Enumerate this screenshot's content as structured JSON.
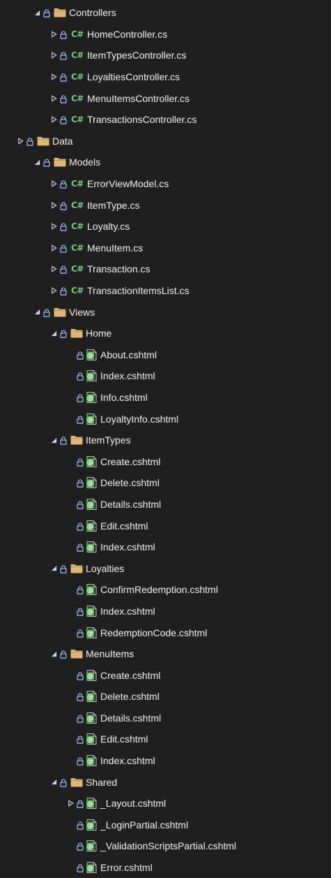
{
  "tree": [
    {
      "depth": 1,
      "expander": "expanded",
      "icon": "folder",
      "label": "Controllers"
    },
    {
      "depth": 2,
      "expander": "collapsed",
      "icon": "csharp",
      "icon_text": "C#",
      "label": "HomeController.cs"
    },
    {
      "depth": 2,
      "expander": "collapsed",
      "icon": "csharp",
      "icon_text": "C#",
      "label": "ItemTypesController.cs"
    },
    {
      "depth": 2,
      "expander": "collapsed",
      "icon": "csharp",
      "icon_text": "C#",
      "label": "LoyaltiesController.cs"
    },
    {
      "depth": 2,
      "expander": "collapsed",
      "icon": "csharp",
      "icon_text": "C#",
      "label": "MenuItemsController.cs"
    },
    {
      "depth": 2,
      "expander": "collapsed",
      "icon": "csharp",
      "icon_text": "C#",
      "label": "TransactionsController.cs"
    },
    {
      "depth": 0,
      "expander": "collapsed",
      "icon": "folder",
      "label": "Data"
    },
    {
      "depth": 1,
      "expander": "expanded",
      "icon": "folder",
      "label": "Models"
    },
    {
      "depth": 2,
      "expander": "collapsed",
      "icon": "csharp",
      "icon_text": "C#",
      "label": "ErrorViewModel.cs"
    },
    {
      "depth": 2,
      "expander": "collapsed",
      "icon": "csharp",
      "icon_text": "C#",
      "label": "ItemType.cs"
    },
    {
      "depth": 2,
      "expander": "collapsed",
      "icon": "csharp",
      "icon_text": "C#",
      "label": "Loyalty.cs"
    },
    {
      "depth": 2,
      "expander": "collapsed",
      "icon": "csharp",
      "icon_text": "C#",
      "label": "MenuItem.cs"
    },
    {
      "depth": 2,
      "expander": "collapsed",
      "icon": "csharp",
      "icon_text": "C#",
      "label": "Transaction.cs"
    },
    {
      "depth": 2,
      "expander": "collapsed",
      "icon": "csharp",
      "icon_text": "C#",
      "label": "TransactionItemsList.cs"
    },
    {
      "depth": 1,
      "expander": "expanded",
      "icon": "folder",
      "label": "Views"
    },
    {
      "depth": 2,
      "expander": "expanded",
      "icon": "folder",
      "label": "Home"
    },
    {
      "depth": 3,
      "expander": "none",
      "icon": "cshtml",
      "label": "About.cshtml"
    },
    {
      "depth": 3,
      "expander": "none",
      "icon": "cshtml",
      "label": "Index.cshtml"
    },
    {
      "depth": 3,
      "expander": "none",
      "icon": "cshtml",
      "label": "Info.cshtml"
    },
    {
      "depth": 3,
      "expander": "none",
      "icon": "cshtml",
      "label": "LoyaltyInfo.cshtml"
    },
    {
      "depth": 2,
      "expander": "expanded",
      "icon": "folder",
      "label": "ItemTypes"
    },
    {
      "depth": 3,
      "expander": "none",
      "icon": "cshtml",
      "label": "Create.cshtml"
    },
    {
      "depth": 3,
      "expander": "none",
      "icon": "cshtml",
      "label": "Delete.cshtml"
    },
    {
      "depth": 3,
      "expander": "none",
      "icon": "cshtml",
      "label": "Details.cshtml"
    },
    {
      "depth": 3,
      "expander": "none",
      "icon": "cshtml",
      "label": "Edit.cshtml"
    },
    {
      "depth": 3,
      "expander": "none",
      "icon": "cshtml",
      "label": "Index.cshtml"
    },
    {
      "depth": 2,
      "expander": "expanded",
      "icon": "folder",
      "label": "Loyalties"
    },
    {
      "depth": 3,
      "expander": "none",
      "icon": "cshtml",
      "label": "ConfirmRedemption.cshtml"
    },
    {
      "depth": 3,
      "expander": "none",
      "icon": "cshtml",
      "label": "Index.cshtml"
    },
    {
      "depth": 3,
      "expander": "none",
      "icon": "cshtml",
      "label": "RedemptionCode.cshtml"
    },
    {
      "depth": 2,
      "expander": "expanded",
      "icon": "folder",
      "label": "MenuItems"
    },
    {
      "depth": 3,
      "expander": "none",
      "icon": "cshtml",
      "label": "Create.cshtml"
    },
    {
      "depth": 3,
      "expander": "none",
      "icon": "cshtml",
      "label": "Delete.cshtml"
    },
    {
      "depth": 3,
      "expander": "none",
      "icon": "cshtml",
      "label": "Details.cshtml"
    },
    {
      "depth": 3,
      "expander": "none",
      "icon": "cshtml",
      "label": "Edit.cshtml"
    },
    {
      "depth": 3,
      "expander": "none",
      "icon": "cshtml",
      "label": "Index.cshtml"
    },
    {
      "depth": 2,
      "expander": "expanded",
      "icon": "folder",
      "label": "Shared"
    },
    {
      "depth": 3,
      "expander": "collapsed",
      "icon": "cshtml",
      "label": "_Layout.cshtml"
    },
    {
      "depth": 3,
      "expander": "none",
      "icon": "cshtml",
      "label": "_LoginPartial.cshtml"
    },
    {
      "depth": 3,
      "expander": "none",
      "icon": "cshtml",
      "label": "_ValidationScriptsPartial.cshtml"
    },
    {
      "depth": 3,
      "expander": "none",
      "icon": "cshtml",
      "label": "Error.cshtml"
    }
  ],
  "colors": {
    "background": "#1f1f1f",
    "text": "#f1f1f1",
    "folder": "#dcb67a",
    "csharp": "#7cc47f",
    "cshtml": "#4fa84f",
    "lock": "#9cb6e8",
    "expander": "#d0d0d0"
  }
}
